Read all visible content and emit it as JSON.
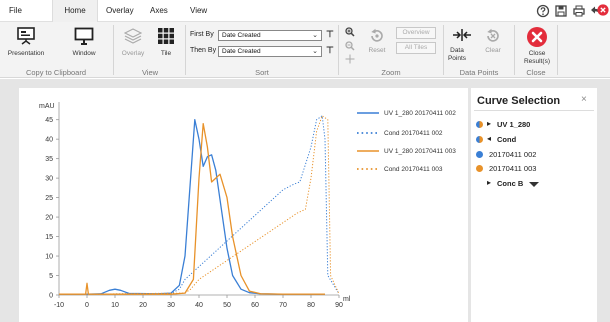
{
  "menu": {
    "items": [
      "File",
      "Home",
      "Overlay",
      "Axes",
      "View"
    ],
    "active": "Home",
    "right_icons": [
      "help-icon",
      "save-icon",
      "print-icon",
      "undo-icon",
      "close-app-icon"
    ]
  },
  "ribbon": {
    "presentation_label": "Presentation",
    "window_label": "Window",
    "copy_group": "Copy to Clipboard",
    "overlay_label": "Overlay",
    "tile_label": "Tile",
    "view_group": "View",
    "first_by_label": "First By",
    "first_by_value": "Date Created",
    "then_by_label": "Then By",
    "then_by_value": "Date Created",
    "sort_group": "Sort",
    "reset_label": "Reset",
    "overview_label": "Overview",
    "all_tiles_label": "All Tiles",
    "zoom_group": "Zoom",
    "data_points_label": "Data Points",
    "clear_label": "Clear",
    "data_points_group": "Data Points",
    "close_results_label": "Close Result(s)",
    "close_group": "Close"
  },
  "chart_data": {
    "type": "line",
    "ylabel": "mAU",
    "xlabel": "ml",
    "xlim": [
      -10,
      90
    ],
    "ylim": [
      0,
      48
    ],
    "xticks": [
      -10,
      0,
      10,
      20,
      30,
      40,
      50,
      60,
      70,
      80,
      90
    ],
    "yticks": [
      0,
      5,
      10,
      15,
      20,
      25,
      30,
      35,
      40,
      45
    ],
    "grid": false,
    "legend_position": "right",
    "series": [
      {
        "name": "UV 1_280 20170411 002",
        "color": "#3a7fd5",
        "style": "solid",
        "x": [
          -10,
          0,
          5,
          8,
          10,
          12,
          15,
          25,
          30,
          33,
          35,
          37,
          38.5,
          40,
          41.5,
          43,
          44.5,
          46,
          48,
          50,
          52,
          55,
          58,
          62,
          68,
          75,
          85
        ],
        "y": [
          0.2,
          0.2,
          0.3,
          1.2,
          1.5,
          1.2,
          0.4,
          0.3,
          0.5,
          2.5,
          10,
          30,
          45,
          40,
          33,
          35.5,
          36,
          32,
          22,
          12,
          5,
          1.5,
          0.6,
          0.3,
          0.2,
          0.2,
          0.2
        ]
      },
      {
        "name": "Cond 20170411 002",
        "color": "#3a7fd5",
        "style": "dotted",
        "x": [
          -10,
          0,
          30,
          33,
          35,
          70,
          74,
          76,
          80,
          82,
          84,
          85,
          86,
          90
        ],
        "y": [
          0.2,
          0.2,
          0.4,
          1.5,
          4,
          27,
          28.5,
          29,
          38,
          45,
          46,
          40,
          5,
          0.3
        ]
      },
      {
        "name": "UV 1_280 20170411 003",
        "color": "#e8922a",
        "style": "solid",
        "x": [
          -10,
          -0.5,
          0,
          0.5,
          30,
          35,
          38,
          40,
          41.5,
          43,
          44.5,
          46,
          47.5,
          50,
          52,
          55,
          58,
          62,
          70,
          85
        ],
        "y": [
          0.2,
          0.2,
          3,
          0.2,
          0.2,
          0.5,
          4,
          30,
          44,
          38,
          29,
          30,
          31,
          25,
          15,
          5,
          1,
          0.3,
          0.2,
          0.2
        ]
      },
      {
        "name": "Cond 20170411 003",
        "color": "#e8922a",
        "style": "dotted",
        "x": [
          -10,
          0,
          35,
          37,
          40,
          75,
          78,
          80,
          82,
          84,
          86,
          87,
          90
        ],
        "y": [
          0.2,
          0.2,
          0.5,
          1.5,
          4,
          21,
          22,
          30,
          42,
          46,
          45,
          5,
          0.3
        ]
      }
    ]
  },
  "legend": [
    {
      "text": "UV 1_280 20170411 002",
      "color": "#3a7fd5",
      "style": "solid"
    },
    {
      "text": "Cond 20170411 002",
      "color": "#3a7fd5",
      "style": "dotted"
    },
    {
      "text": "UV 1_280 20170411 003",
      "color": "#e8922a",
      "style": "solid"
    },
    {
      "text": "Cond 20170411 003",
      "color": "#e8922a",
      "style": "dotted"
    }
  ],
  "curve_selection": {
    "title": "Curve Selection",
    "close_glyph": "×",
    "items": [
      {
        "label": "UV 1_280",
        "bold": true,
        "marker": "half",
        "arrow": "▸"
      },
      {
        "label": "Cond",
        "bold": true,
        "marker": "half",
        "arrow": "◂"
      },
      {
        "label": "20170411 002",
        "bold": false,
        "marker": "#3a7fd5"
      },
      {
        "label": "20170411 003",
        "bold": false,
        "marker": "#e8922a"
      },
      {
        "label": "Conc B",
        "bold": true,
        "marker": "",
        "arrow": "▸"
      }
    ]
  },
  "colors": {
    "accent_blue": "#3a7fd5",
    "accent_orange": "#e8922a",
    "close_red": "#e32d3c"
  }
}
